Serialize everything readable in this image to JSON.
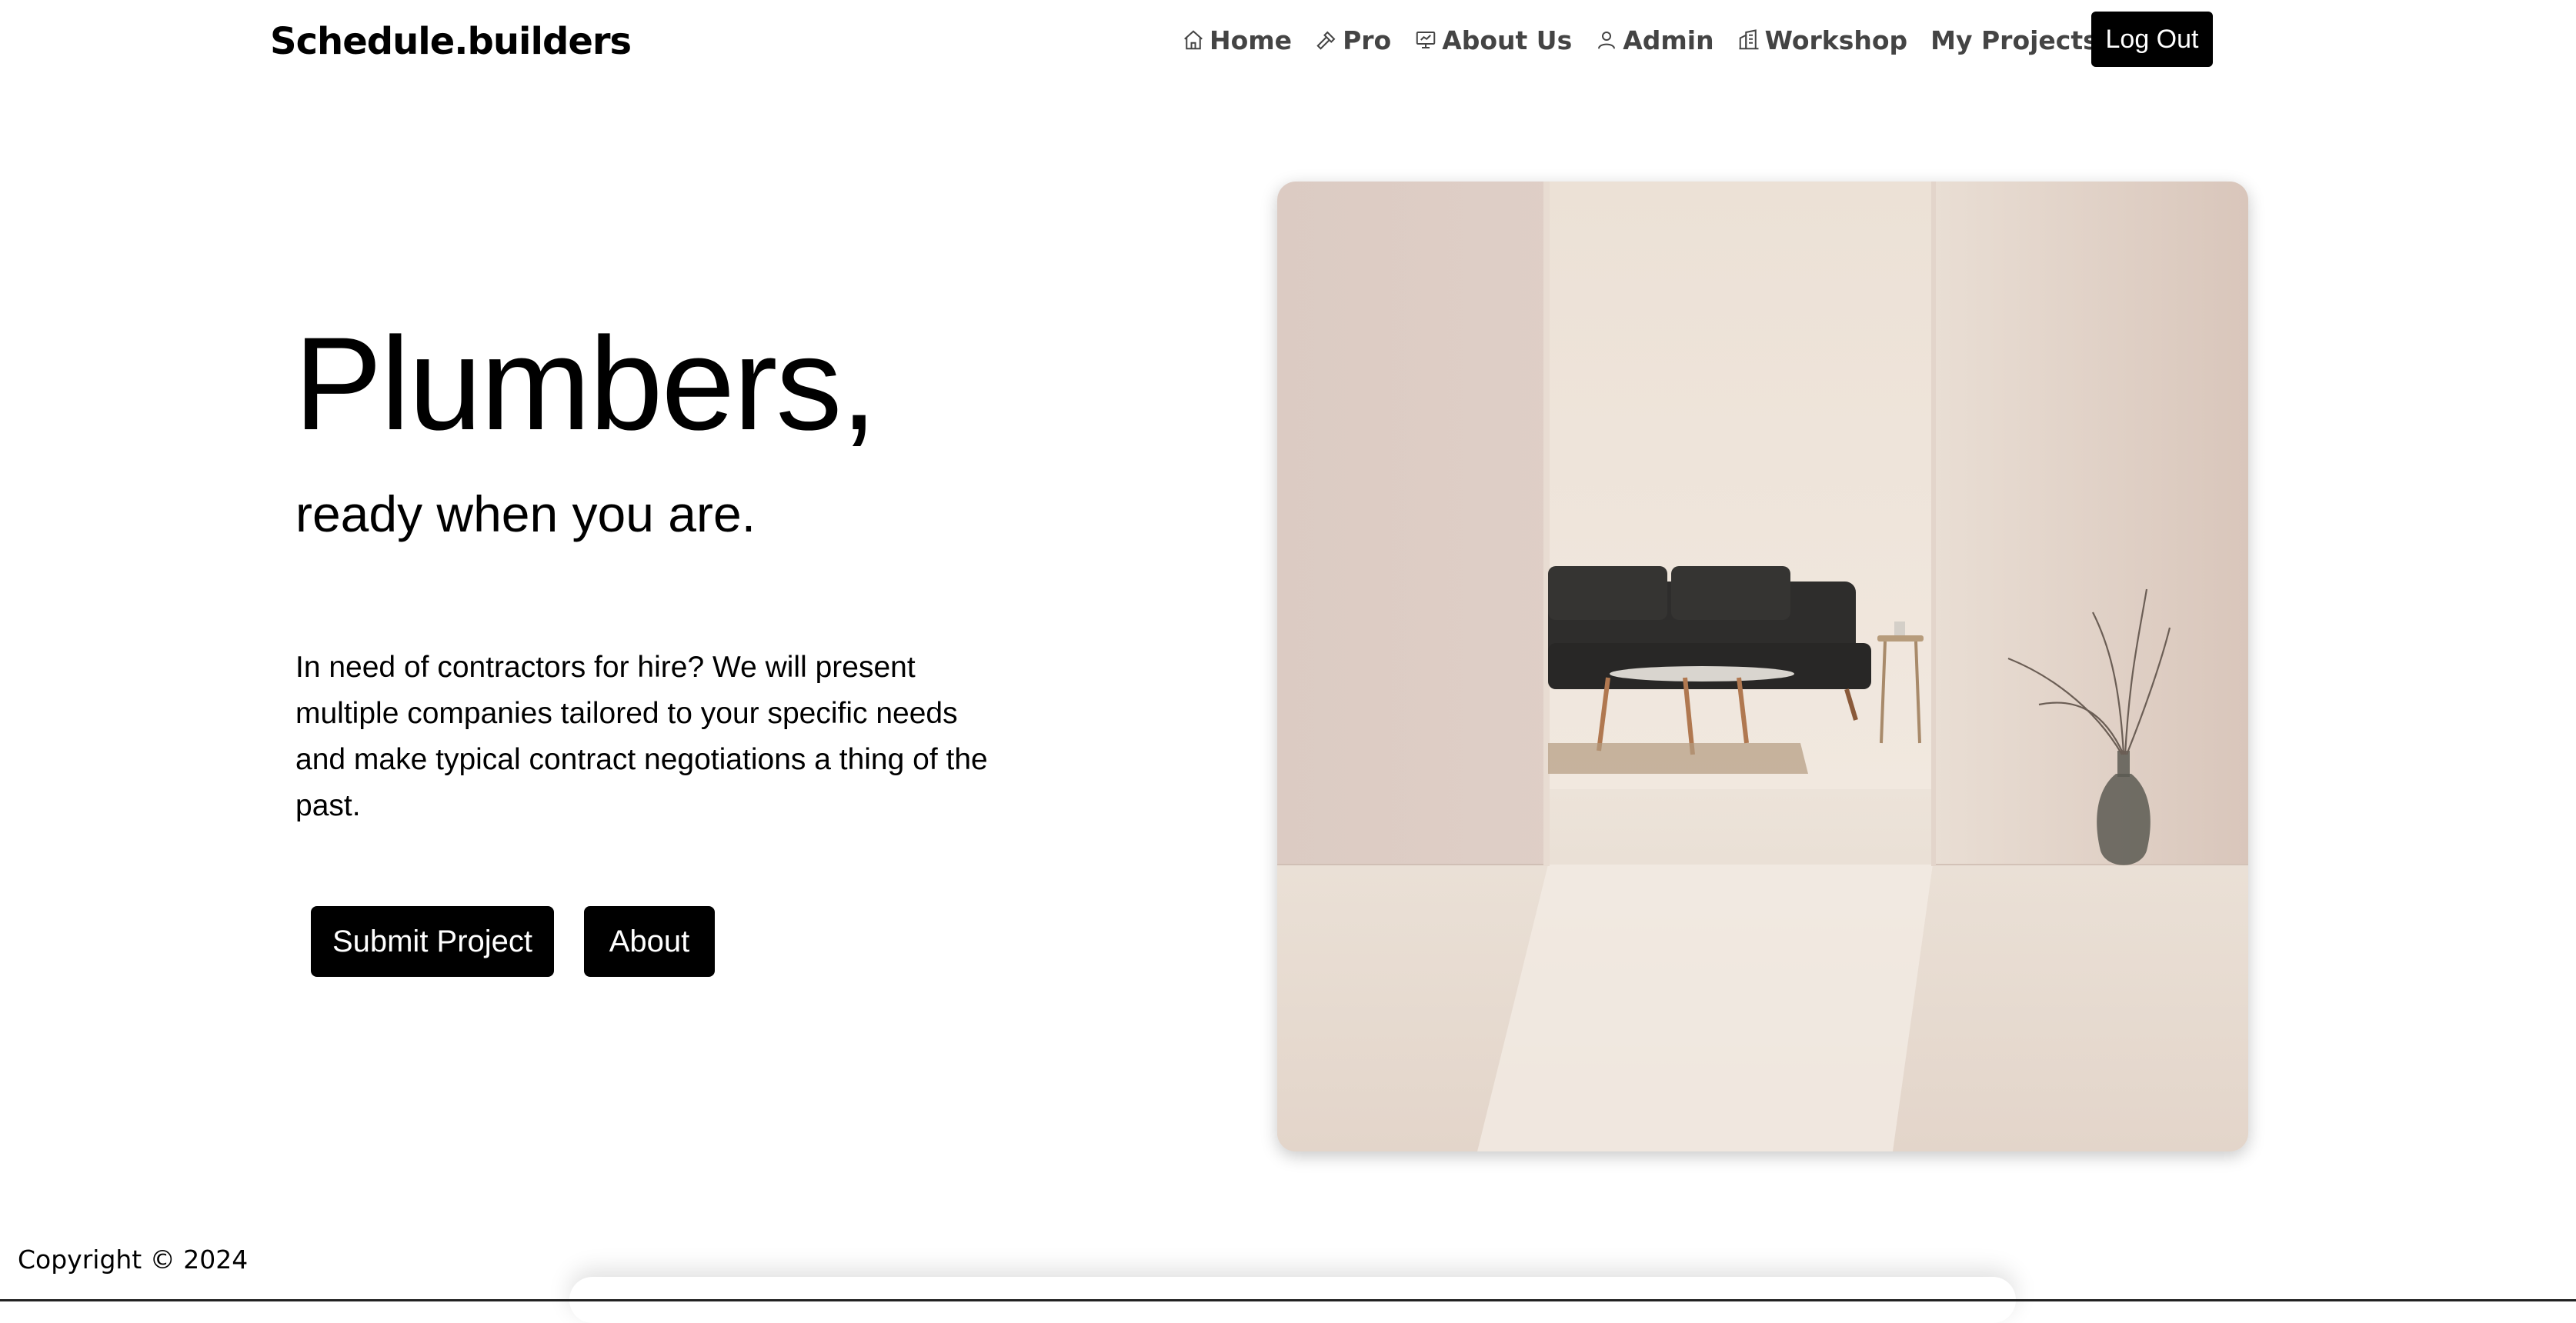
{
  "brand": "Schedule.builders",
  "nav": [
    {
      "label": "Home",
      "icon": "home-icon"
    },
    {
      "label": "Pro",
      "icon": "hammer-icon"
    },
    {
      "label": "About Us",
      "icon": "presentation-icon"
    },
    {
      "label": "Admin",
      "icon": "user-icon"
    },
    {
      "label": "Workshop",
      "icon": "building-icon"
    },
    {
      "label": "My Projects",
      "icon": ""
    }
  ],
  "logout_label": "Log Out",
  "hero": {
    "title": "Plumbers,",
    "subtitle": "ready when you are.",
    "body": "In need of contractors for hire? We will present multiple companies tailored to your specific needs and make typical contract negotiations a thing of the past.",
    "submit_label": "Submit Project",
    "about_label": "About"
  },
  "footer": {
    "copyright": "Copyright © 2024"
  },
  "colors": {
    "button_bg": "#000000",
    "button_text": "#ffffff",
    "nav_text": "#444444"
  }
}
